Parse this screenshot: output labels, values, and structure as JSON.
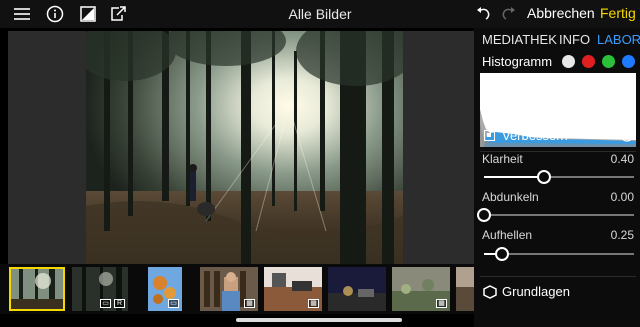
{
  "window": {
    "title": "Alle Bilder"
  },
  "toolbar": {
    "cancel_label": "Abbrechen",
    "done_label": "Fertig",
    "accent": "#f5d800"
  },
  "panel": {
    "tabs": [
      {
        "label": "MEDIATHEK",
        "active": false
      },
      {
        "label": "INFO",
        "active": false
      },
      {
        "label": "LABOR",
        "active": true
      }
    ],
    "tab_active_color": "#3b9bff",
    "histogram_label": "Histogramm",
    "channel_dots": [
      "#e8e8e8",
      "#e02020",
      "#2bbf3a",
      "#1e7bff"
    ],
    "enhance": {
      "label": "Verbessern",
      "sliders": [
        {
          "label": "Klarheit",
          "value": "0.40",
          "fraction": 0.4
        },
        {
          "label": "Abdunkeln",
          "value": "0.00",
          "fraction": 0.0
        },
        {
          "label": "Aufhellen",
          "value": "0.25",
          "fraction": 0.12
        }
      ]
    },
    "basics_label": "Grundlagen"
  },
  "filmstrip": {
    "selected_index": 0,
    "thumbs": [
      {
        "kind": "forest",
        "badges": []
      },
      {
        "kind": "forest-dark",
        "badges": [
          "portrait",
          "R"
        ]
      },
      {
        "kind": "leaves",
        "badges": [
          "portrait"
        ]
      },
      {
        "kind": "bookshelf",
        "badges": [
          "film"
        ]
      },
      {
        "kind": "kitchen",
        "badges": [
          "film"
        ]
      },
      {
        "kind": "night",
        "badges": []
      },
      {
        "kind": "garden",
        "badges": [
          "film"
        ]
      },
      {
        "kind": "partial",
        "badges": []
      }
    ]
  }
}
